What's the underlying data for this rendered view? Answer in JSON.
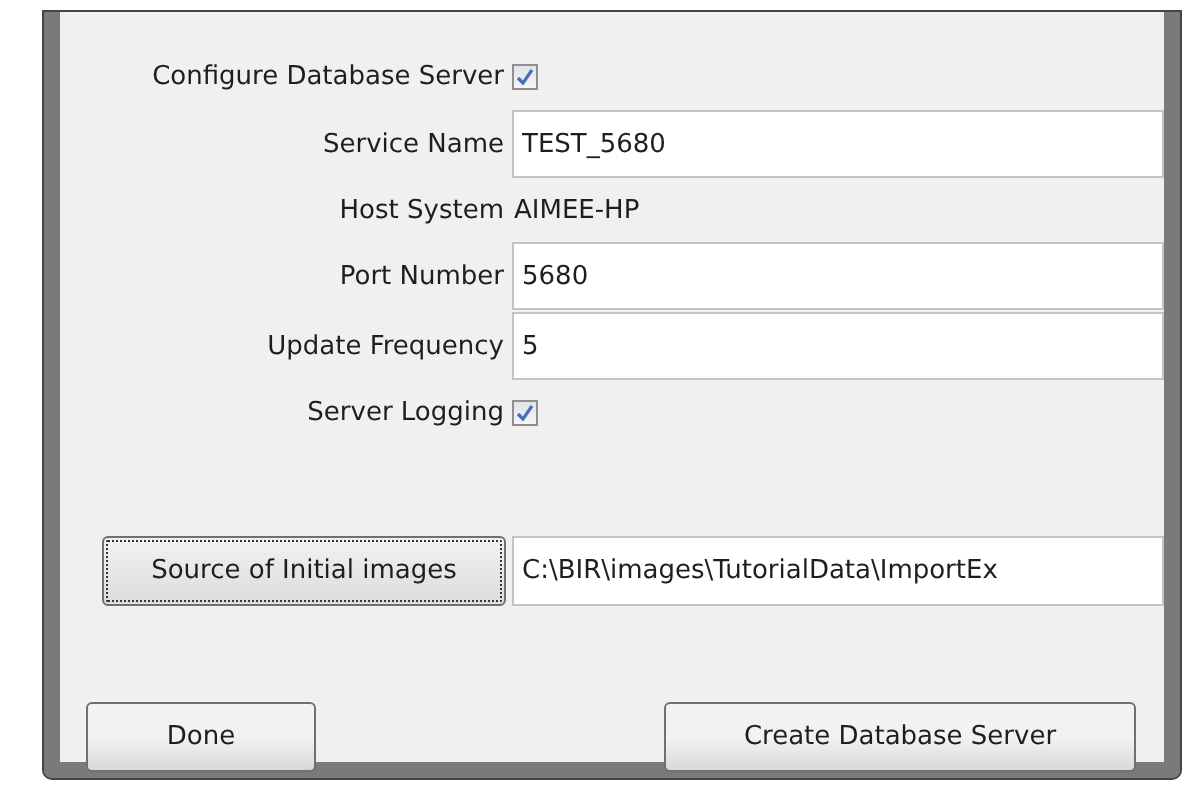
{
  "form": {
    "rows": [
      {
        "kind": "checkbox",
        "label": "Configure Database Server",
        "checked": true
      },
      {
        "kind": "field",
        "label": "Service Name",
        "value": "TEST_5680"
      },
      {
        "kind": "text",
        "label": "Host System",
        "value": "AIMEE-HP"
      },
      {
        "kind": "field",
        "label": "Port Number",
        "value": "5680"
      },
      {
        "kind": "field",
        "label": "Update Frequency",
        "value": "5"
      },
      {
        "kind": "checkbox",
        "label": "Server Logging",
        "checked": true
      }
    ]
  },
  "source": {
    "button": "Source of Initial images",
    "path": "C:\\BIR\\images\\TutorialData\\ImportEx"
  },
  "buttons": [
    "Done",
    "Create Database Server"
  ]
}
